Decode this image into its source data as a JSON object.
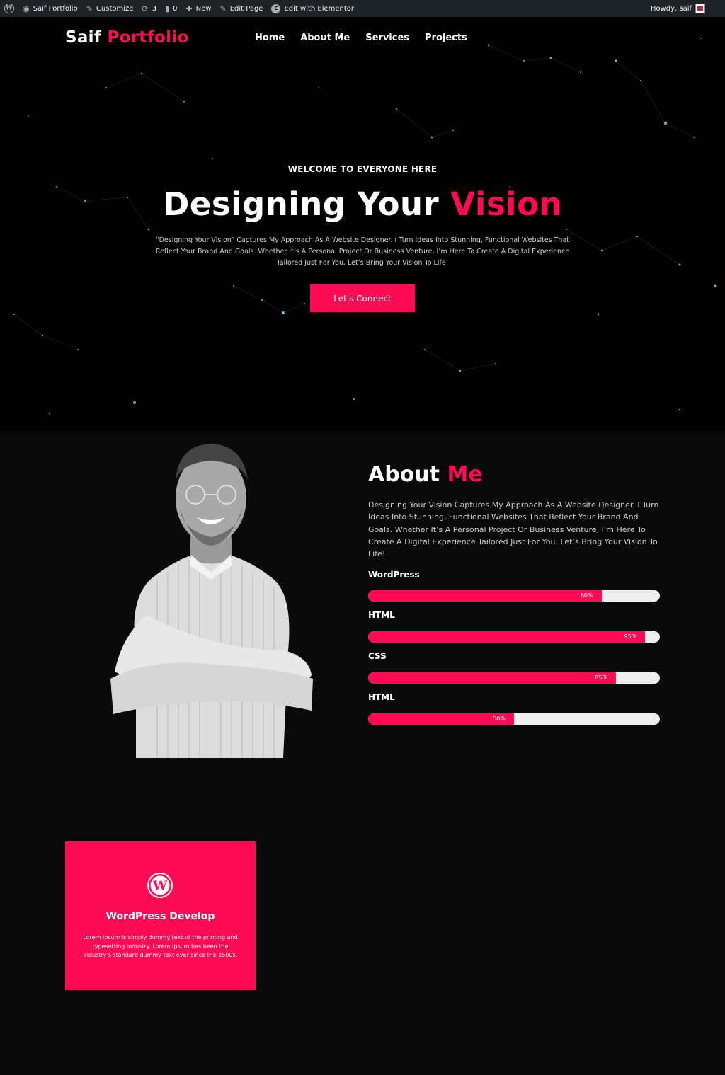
{
  "admin_bar": {
    "site_name": "Saif Portfolio",
    "customize": "Customize",
    "updates_count": "3",
    "comments_count": "0",
    "new": "New",
    "edit_page": "Edit Page",
    "edit_elementor": "Edit with Elementor",
    "howdy": "Howdy, saif"
  },
  "header": {
    "logo_main": "Saif",
    "logo_accent": "Portfolio",
    "nav": [
      "Home",
      "About Me",
      "Services",
      "Projects"
    ]
  },
  "hero": {
    "eyebrow": "WELCOME TO EVERYONE HERE",
    "title_main": "Designing Your",
    "title_accent": "Vision",
    "description": "“Designing Your Vision” Captures My Approach As A Website Designer. I Turn Ideas Into Stunning, Functional Websites That Reflect Your Brand And Goals. Whether It’s A Personal Project Or Business Venture, I’m Here To Create A Digital Experience Tailored Just For You. Let’s Bring Your Vision To Life!",
    "button": "Let's Connect"
  },
  "about": {
    "title_main": "About",
    "title_accent": "Me",
    "description": "Designing Your Vision Captures My Approach As A Website Designer. I Turn Ideas Into Stunning, Functional Websites That Reflect Your Brand And Goals. Whether It’s A Personal Project Or Business Venture, I’m Here To Create A Digital Experience Tailored Just For You. Let’s Bring Your Vision To Life!",
    "skills": [
      {
        "label": "WordPress",
        "percent_text": "80%",
        "value": 80
      },
      {
        "label": "HTML",
        "percent_text": "95%",
        "value": 95
      },
      {
        "label": "CSS",
        "percent_text": "85%",
        "value": 85
      },
      {
        "label": "HTML",
        "percent_text": "50%",
        "value": 50
      }
    ]
  },
  "service_card": {
    "icon": "wordpress-icon",
    "title": "WordPress Develop",
    "text": "Lorem Ipsum is simply dummy text of the printing and typesetting industry. Lorem Ipsum has been the industry's standard dummy text ever since the 1500s."
  },
  "colors": {
    "accent": "#ff0a54",
    "admin_bar": "#1d2327",
    "background": "#0a0a0a"
  }
}
